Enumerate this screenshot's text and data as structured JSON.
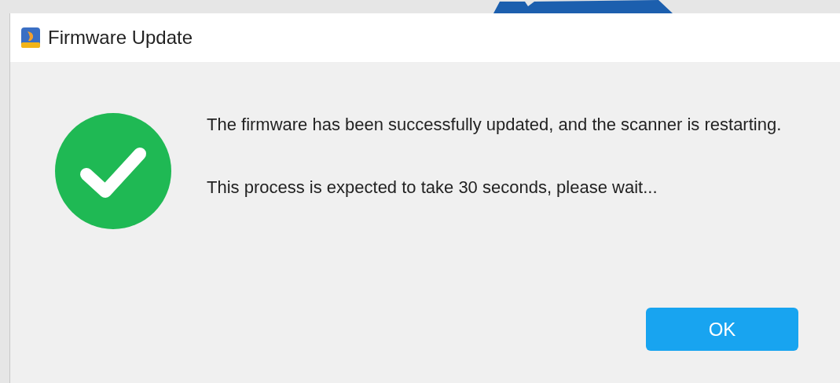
{
  "window": {
    "title": "Firmware Update"
  },
  "message": {
    "lines": [
      "The firmware has been successfully updated, and the scanner is restarting.",
      "This process is expected to take 30 seconds, please wait..."
    ]
  },
  "buttons": [
    {
      "label": "OK"
    }
  ]
}
